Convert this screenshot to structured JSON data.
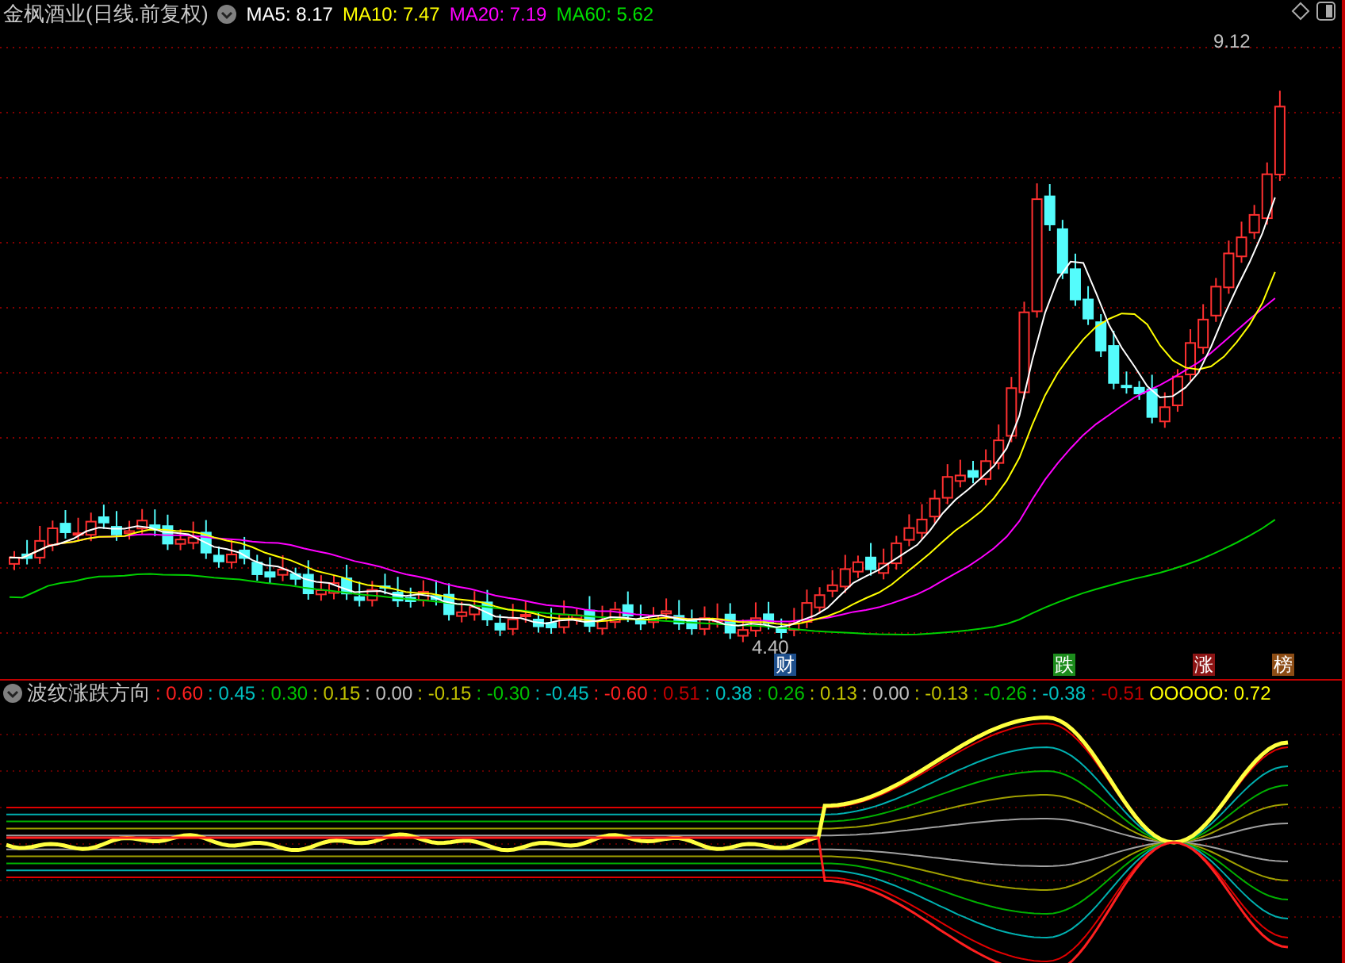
{
  "title": "金枫酒业(日线.前复权)",
  "ma_labels": [
    {
      "text": "MA5: 8.17",
      "color": "#ffffff"
    },
    {
      "text": "MA10: 7.47",
      "color": "#ffff00"
    },
    {
      "text": "MA20: 7.19",
      "color": "#ff00ff"
    },
    {
      "text": "MA60: 5.62",
      "color": "#00e000"
    }
  ],
  "high_label": "9.12",
  "low_label": "4.40",
  "badges": [
    {
      "text": "财",
      "color": "#1e4f8c"
    },
    {
      "text": "跌",
      "color": "#1c8c1c"
    },
    {
      "text": "涨",
      "color": "#8c1414"
    },
    {
      "text": "榜",
      "color": "#8c4c14"
    }
  ],
  "indicator": {
    "title": "波纹涨跌方向",
    "values": [
      {
        "text": ": 0.60",
        "color": "#ff2020"
      },
      {
        "text": ": 0.45",
        "color": "#00c0c0"
      },
      {
        "text": ": 0.30",
        "color": "#00c000"
      },
      {
        "text": ": 0.15",
        "color": "#c0c000"
      },
      {
        "text": ": 0.00",
        "color": "#c0c0c0"
      },
      {
        "text": ": -0.15",
        "color": "#c0c000"
      },
      {
        "text": ": -0.30",
        "color": "#00c000"
      },
      {
        "text": ": -0.45",
        "color": "#00c0c0"
      },
      {
        "text": ": -0.60",
        "color": "#ff2020"
      },
      {
        "text": ": 0.51",
        "color": "#c00000"
      },
      {
        "text": ": 0.38",
        "color": "#00c0c0"
      },
      {
        "text": ": 0.26",
        "color": "#00c000"
      },
      {
        "text": ": 0.13",
        "color": "#c0c000"
      },
      {
        "text": ": 0.00",
        "color": "#c0c0c0"
      },
      {
        "text": ": -0.13",
        "color": "#c0c000"
      },
      {
        "text": ": -0.26",
        "color": "#00c000"
      },
      {
        "text": ": -0.38",
        "color": "#00c0c0"
      },
      {
        "text": ": -0.51",
        "color": "#c00000"
      },
      {
        "text": "OOOOO: 0.72",
        "color": "#ffff00"
      }
    ]
  }
}
